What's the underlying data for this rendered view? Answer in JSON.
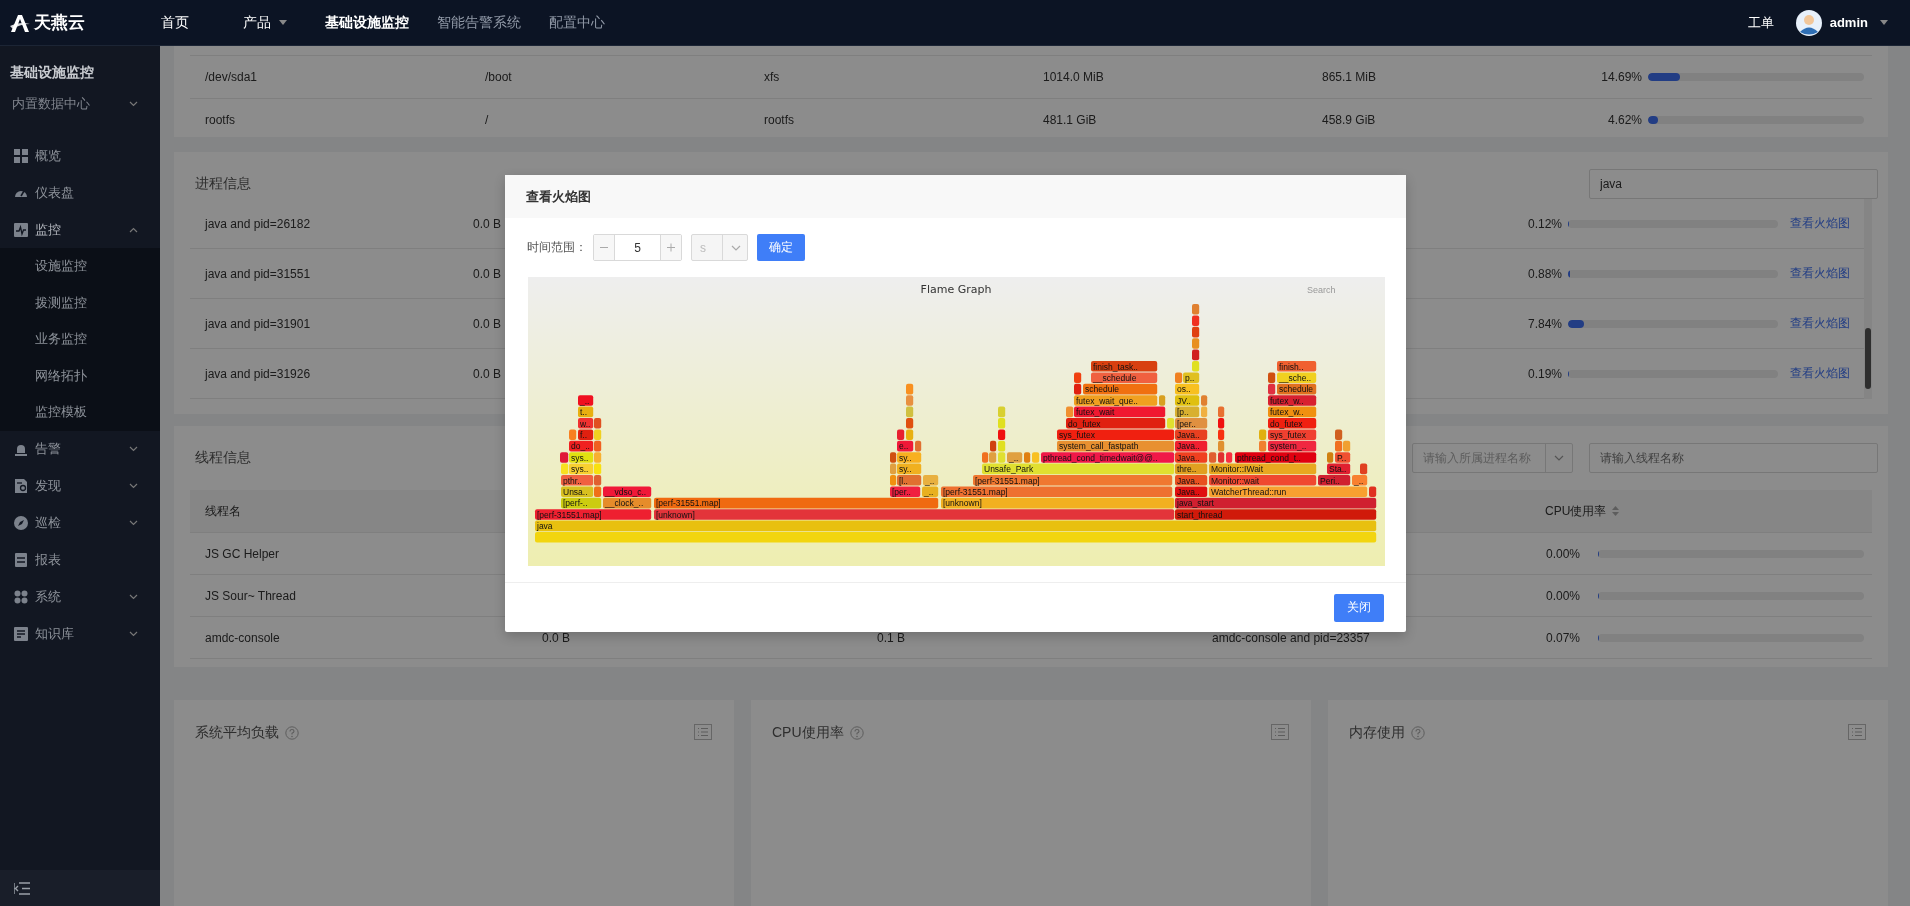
{
  "top_nav": {
    "logo": "天燕云",
    "items": [
      {
        "label": "首页",
        "selected": false,
        "dropdown": false,
        "disabled": false
      },
      {
        "label": "产品",
        "selected": false,
        "dropdown": true,
        "disabled": false
      },
      {
        "label": "基础设施监控",
        "selected": true,
        "dropdown": false,
        "disabled": false
      },
      {
        "label": "智能告警系统",
        "selected": false,
        "dropdown": false,
        "disabled": true
      },
      {
        "label": "配置中心",
        "selected": false,
        "dropdown": false,
        "disabled": true
      }
    ],
    "ticket": "工单",
    "user": "admin"
  },
  "sidebar": {
    "title": "基础设施监控",
    "datacenter": "内置数据中心",
    "items": [
      {
        "label": "概览",
        "kind": "link"
      },
      {
        "label": "仪表盘",
        "kind": "link"
      },
      {
        "label": "监控",
        "kind": "group",
        "expanded": true,
        "children": [
          {
            "label": "设施监控"
          },
          {
            "label": "拨测监控"
          },
          {
            "label": "业务监控"
          },
          {
            "label": "网络拓扑"
          },
          {
            "label": "监控模板"
          }
        ]
      },
      {
        "label": "告警",
        "kind": "group",
        "expanded": false
      },
      {
        "label": "发现",
        "kind": "group",
        "expanded": false
      },
      {
        "label": "巡检",
        "kind": "group",
        "expanded": false
      },
      {
        "label": "报表",
        "kind": "link"
      },
      {
        "label": "系统",
        "kind": "group",
        "expanded": false
      },
      {
        "label": "知识库",
        "kind": "group",
        "expanded": false
      }
    ]
  },
  "disk_table": {
    "rows": [
      {
        "cells": [
          "/dev/sda1",
          "/boot",
          "xfs",
          "1014.0 MiB",
          "865.1 MiB"
        ],
        "usage": "14.69%",
        "level": 0.1469
      },
      {
        "cells": [
          "rootfs",
          "/",
          "rootfs",
          "481.1 GiB",
          "458.9 GiB"
        ],
        "usage": "4.62%",
        "level": 0.0462
      }
    ]
  },
  "process_info": {
    "title": "进程信息",
    "search": {
      "value": "java"
    },
    "rows": [
      {
        "cells": [
          "java and pid=26182",
          "0.0 B"
        ],
        "cpu": "0.12%",
        "level": 0.0012,
        "action": "查看火焰图"
      },
      {
        "cells": [
          "java and pid=31551",
          "0.0 B"
        ],
        "cpu": "0.88%",
        "level": 0.0088,
        "action": "查看火焰图"
      },
      {
        "cells": [
          "java and pid=31901",
          "0.0 B"
        ],
        "cpu": "7.84%",
        "level": 0.0784,
        "action": "查看火焰图"
      },
      {
        "cells": [
          "java and pid=31926",
          "0.0 B"
        ],
        "cpu": "0.19%",
        "level": 0.0019,
        "action": "查看火焰图"
      }
    ]
  },
  "thread_info": {
    "title": "线程信息",
    "process_select": {
      "placeholder": "请输入所属进程名称"
    },
    "thread_search": {
      "placeholder": "请输入线程名称"
    },
    "columns": [
      {
        "label": "线程名",
        "sortable": false
      },
      {
        "label": "CPU使用率",
        "sortable": true
      }
    ],
    "rows": [
      {
        "cells": [
          "JS GC Helper"
        ],
        "cpu": "0.00%",
        "level": 0
      },
      {
        "cells": [
          "JS Sour~ Thread"
        ],
        "cpu": "0.00%",
        "level": 0
      },
      {
        "cells": [
          "amdc-console",
          "0.0 B",
          "0.1 B",
          "amdc-console and pid=23357"
        ],
        "cpu": "0.07%",
        "level": 0.0007
      }
    ]
  },
  "panels": [
    {
      "title": "系统平均负载"
    },
    {
      "title": "CPU使用率"
    },
    {
      "title": "内存使用"
    }
  ],
  "modal": {
    "title": "查看火焰图",
    "time_range": {
      "label": "时间范围：",
      "value": "5",
      "unit": "s",
      "unit_disabled": true
    },
    "confirm": "确定",
    "close": "关闭",
    "flame_graph": {
      "title": "Flame Graph",
      "search": "Search",
      "frames": [
        "java",
        "[perf-31551.map]",
        "[unknown]",
        "start_thread",
        "[perf-..",
        "__clock_..",
        "[perf-31551.map]",
        "[unknown]",
        "java_start",
        "Unsa..",
        "__vdso_c..",
        "[per..",
        "_..",
        "[perf-31551.map]",
        "Java..",
        "WatcherThread::run",
        "pthr..",
        "[l..",
        "_..",
        "[perf-31551.map]",
        "Java..",
        "Monitor::wait",
        "Peri..",
        "_..",
        "sys..",
        "sy..",
        "Unsafe_Park",
        "thre..",
        "Monitor::IWait",
        "Sta..",
        "sys..",
        "sy..",
        "_..",
        "pthread_cond_timedwait@@..",
        "Java..",
        "pthread_cond_t..",
        "P..",
        "do_..",
        "e..",
        "system_call_fastpath",
        "Java..",
        "system_..",
        "f..",
        "sys_futex",
        "Java..",
        "sys_futex",
        "w..",
        "do_futex",
        "[per..",
        "do_futex",
        "t..",
        "futex_wait",
        "[p..",
        "futex_w..",
        "_..",
        "futex_wait_que..",
        "JV..",
        "futex_w..",
        "schedule",
        "os..",
        "schedule",
        "__schedule",
        "p..",
        "__sche..",
        "finish_task..",
        "finish.."
      ]
    }
  }
}
